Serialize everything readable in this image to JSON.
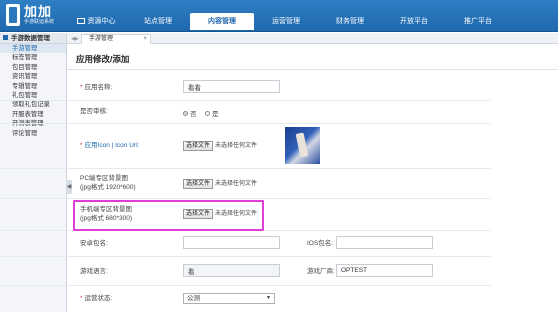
{
  "app": {
    "logo_title": "加加",
    "logo_subtitle": "手游联运系统"
  },
  "nav": {
    "items": [
      {
        "label": "资源中心"
      },
      {
        "label": "站点管理"
      },
      {
        "label": "内容管理"
      },
      {
        "label": "运营管理"
      },
      {
        "label": "财务管理"
      },
      {
        "label": "开放平台"
      },
      {
        "label": "推广平台"
      }
    ],
    "active": "内容管理"
  },
  "sidebar": {
    "heading": "手游数据管理",
    "items": [
      {
        "label": "手游管理"
      },
      {
        "label": "标签管理"
      },
      {
        "label": "包目管理"
      },
      {
        "label": "资讯管理"
      },
      {
        "label": "专辑管理"
      },
      {
        "label": "礼包管理"
      },
      {
        "label": "领取礼包记录"
      },
      {
        "label": "开服表管理"
      },
      {
        "label": "开测表管理"
      },
      {
        "label": "评论管理"
      }
    ]
  },
  "tabs": {
    "active_label": "手游管理",
    "close_label": "×"
  },
  "page": {
    "title": "应用修改/添加"
  },
  "form": {
    "app_name": {
      "label": "应用名称:",
      "value": "看看"
    },
    "review": {
      "label": "是否审核:",
      "options": [
        "否",
        "是"
      ],
      "selected": "否"
    },
    "icon": {
      "label": "应用Icon | Icon Url:",
      "button": "选择文件",
      "status": "未选择任何文件"
    },
    "pc_bg": {
      "label_line1": "PC端专区背景图",
      "label_line2": "(jpg格式 1920*600)",
      "button": "选择文件",
      "status": "未选择任何文件"
    },
    "mobile_bg": {
      "label_line1": "手机端专区背景图",
      "label_line2": "(jpg格式 680*300)",
      "button": "选择文件",
      "status": "未选择任何文件"
    },
    "android_pkg": {
      "label": "安卓包名:",
      "value": ""
    },
    "ios_pkg": {
      "label": "IOS包名:",
      "value": ""
    },
    "game_language": {
      "label": "游戏语言:",
      "value": "看"
    },
    "vendor": {
      "label": "游戏厂商:",
      "value": "OPTEST"
    },
    "status": {
      "label": "运营状态:",
      "value": "公测",
      "caret": "▼"
    }
  },
  "colors": {
    "brand": "#1f68ad",
    "required": "#d9363e",
    "highlight": "#e23bd6"
  }
}
